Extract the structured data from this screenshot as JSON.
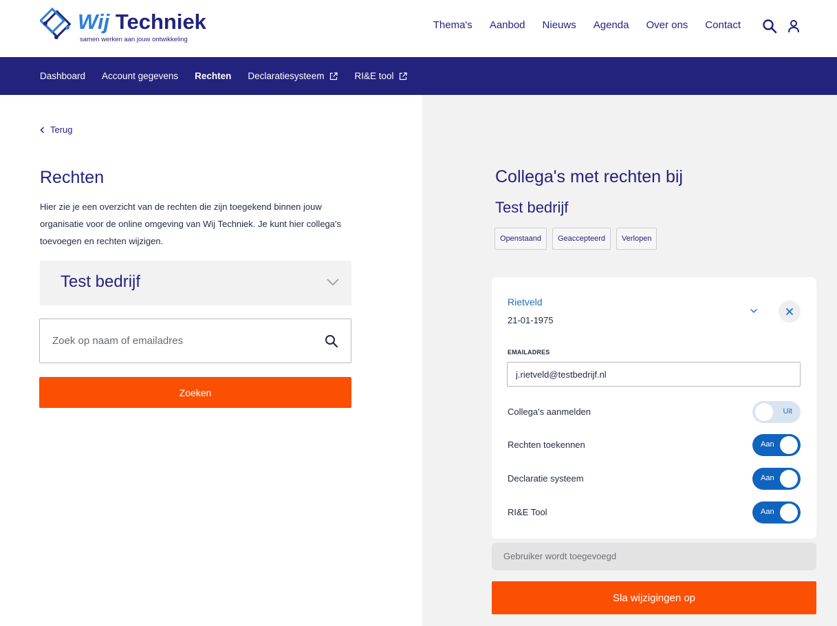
{
  "header": {
    "logo": {
      "brand_prefix": "Wij",
      "brand_name": "Techniek",
      "tagline": "samen werken aan jouw ontwikkeling"
    },
    "nav": [
      "Thema's",
      "Aanbod",
      "Nieuws",
      "Agenda",
      "Over ons",
      "Contact"
    ]
  },
  "subnav": {
    "items": [
      {
        "label": "Dashboard",
        "active": false,
        "external": false
      },
      {
        "label": "Account gegevens",
        "active": false,
        "external": false
      },
      {
        "label": "Rechten",
        "active": true,
        "external": false
      },
      {
        "label": "Declaratiesysteem",
        "active": false,
        "external": true
      },
      {
        "label": "RI&E tool",
        "active": false,
        "external": true
      }
    ]
  },
  "left": {
    "back_label": "Terug",
    "title": "Rechten",
    "intro": "Hier zie je een overzicht van de rechten die zijn toegekend binnen jouw organisatie voor de online omgeving van Wij Techniek. Je kunt hier colle­ga's toevoegen en rechten wijzigen.",
    "company": "Test bedrijf",
    "search": {
      "placeholder": "Zoek op naam of emailadres",
      "value": ""
    },
    "search_button": "Zoeken"
  },
  "right": {
    "title_line1": "Collega's met rechten bij",
    "title_line2": "Test bedrijf",
    "filters": [
      "Openstaand",
      "Geaccepteerd",
      "Verlopen"
    ],
    "card": {
      "name": "Rietveld",
      "date": "21-01-1975",
      "email_label": "EMAILADRES",
      "email_value": "j.rietveld@testbedrijf.nl",
      "permissions": [
        {
          "label": "Collega's aanmelden",
          "enabled": false,
          "state_label": "Uit"
        },
        {
          "label": "Rechten toekennen",
          "enabled": true,
          "state_label": "Aan"
        },
        {
          "label": "Declaratie systeem",
          "enabled": true,
          "state_label": "Aan"
        },
        {
          "label": "RI&E Tool",
          "enabled": true,
          "state_label": "Aan"
        }
      ]
    },
    "status_text": "Gebruiker wordt toegevoegd",
    "save_button": "Sla wijzigingen op"
  },
  "colors": {
    "navy": "#23237e",
    "orange": "#fb5004",
    "toggle_blue": "#1064bf",
    "panel_gray": "#f2f2f2"
  },
  "icons": [
    "logo-mark-icon",
    "search-icon",
    "user-icon",
    "external-link-icon",
    "chevron-left-icon",
    "chevron-down-icon",
    "close-icon"
  ]
}
